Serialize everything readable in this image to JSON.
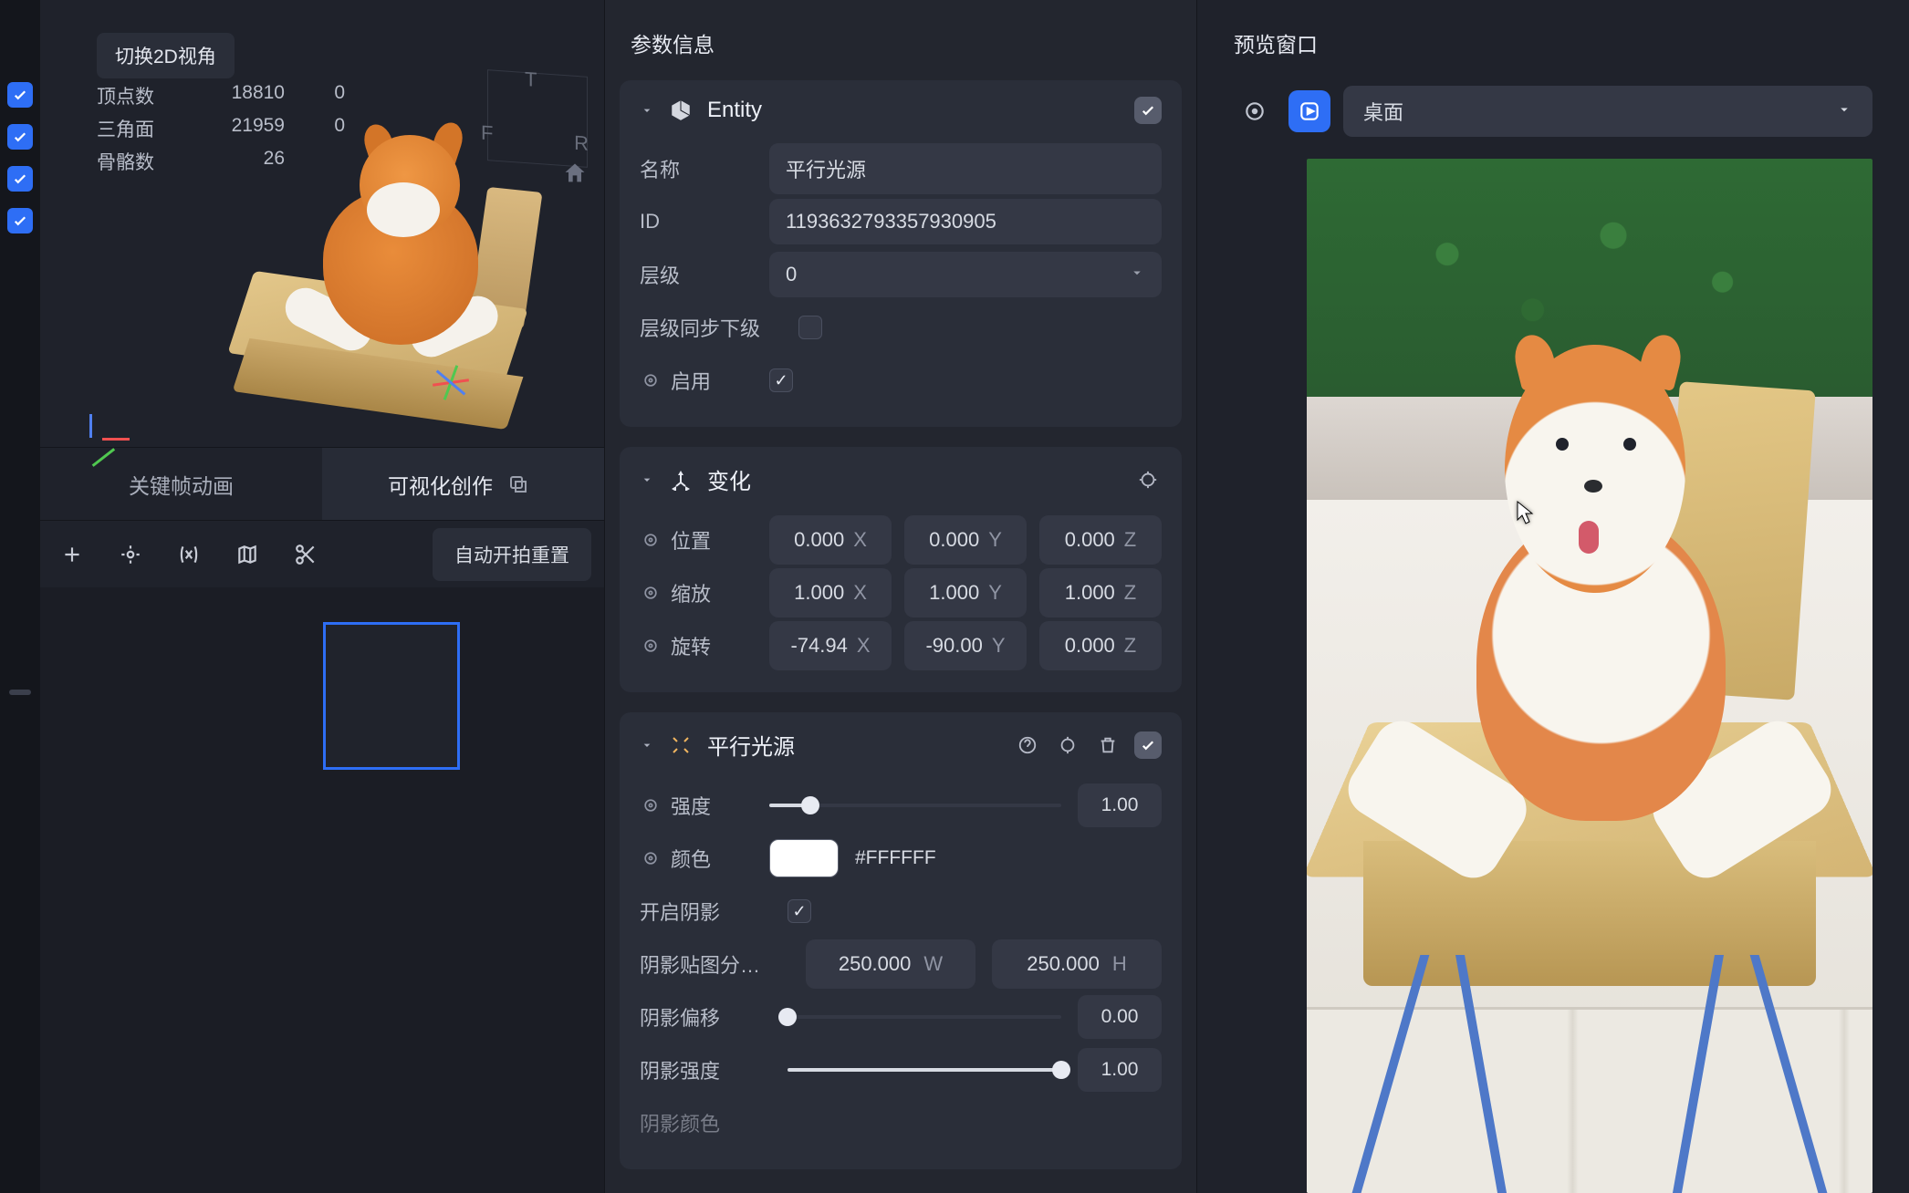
{
  "left": {
    "viewport": {
      "switch_2d": "切换2D视角",
      "stats": {
        "vertices_label": "顶点数",
        "vertices": "18810",
        "vertices_extra": "0",
        "tris_label": "三角面",
        "tris": "21959",
        "tris_extra": "0",
        "bones_label": "骨骼数",
        "bones": "26"
      },
      "orient": {
        "top": "T",
        "left": "F",
        "right": "R"
      }
    },
    "tabs": {
      "keyframe": "关键帧动画",
      "visual": "可视化创作"
    },
    "auto_reset": "自动开拍重置"
  },
  "params": {
    "title": "参数信息",
    "entity": {
      "title": "Entity",
      "name_label": "名称",
      "name_value": "平行光源",
      "id_label": "ID",
      "id_value": "1193632793357930905",
      "layer_label": "层级",
      "layer_value": "0",
      "sync_label": "层级同步下级",
      "enabled_label": "启用"
    },
    "transform": {
      "title": "变化",
      "pos_label": "位置",
      "pos": {
        "x": "0.000",
        "y": "0.000",
        "z": "0.000"
      },
      "scale_label": "缩放",
      "scale": {
        "x": "1.000",
        "y": "1.000",
        "z": "1.000"
      },
      "rot_label": "旋转",
      "rot": {
        "x": "-74.94",
        "y": "-90.00",
        "z": "0.000"
      }
    },
    "light": {
      "title": "平行光源",
      "intensity_label": "强度",
      "intensity_value": "1.00",
      "color_label": "颜色",
      "color_hex": "#FFFFFF",
      "shadow_enable_label": "开启阴影",
      "shadow_map_label": "阴影贴图分…",
      "shadow_map": {
        "w": "250.000",
        "h": "250.000"
      },
      "shadow_bias_label": "阴影偏移",
      "shadow_bias_value": "0.00",
      "shadow_strength_label": "阴影强度",
      "shadow_strength_value": "1.00",
      "shadow_color_label": "阴影颜色"
    }
  },
  "preview": {
    "title": "预览窗口",
    "device": "桌面"
  },
  "axes": {
    "x": "X",
    "y": "Y",
    "z": "Z",
    "w": "W",
    "h": "H"
  }
}
